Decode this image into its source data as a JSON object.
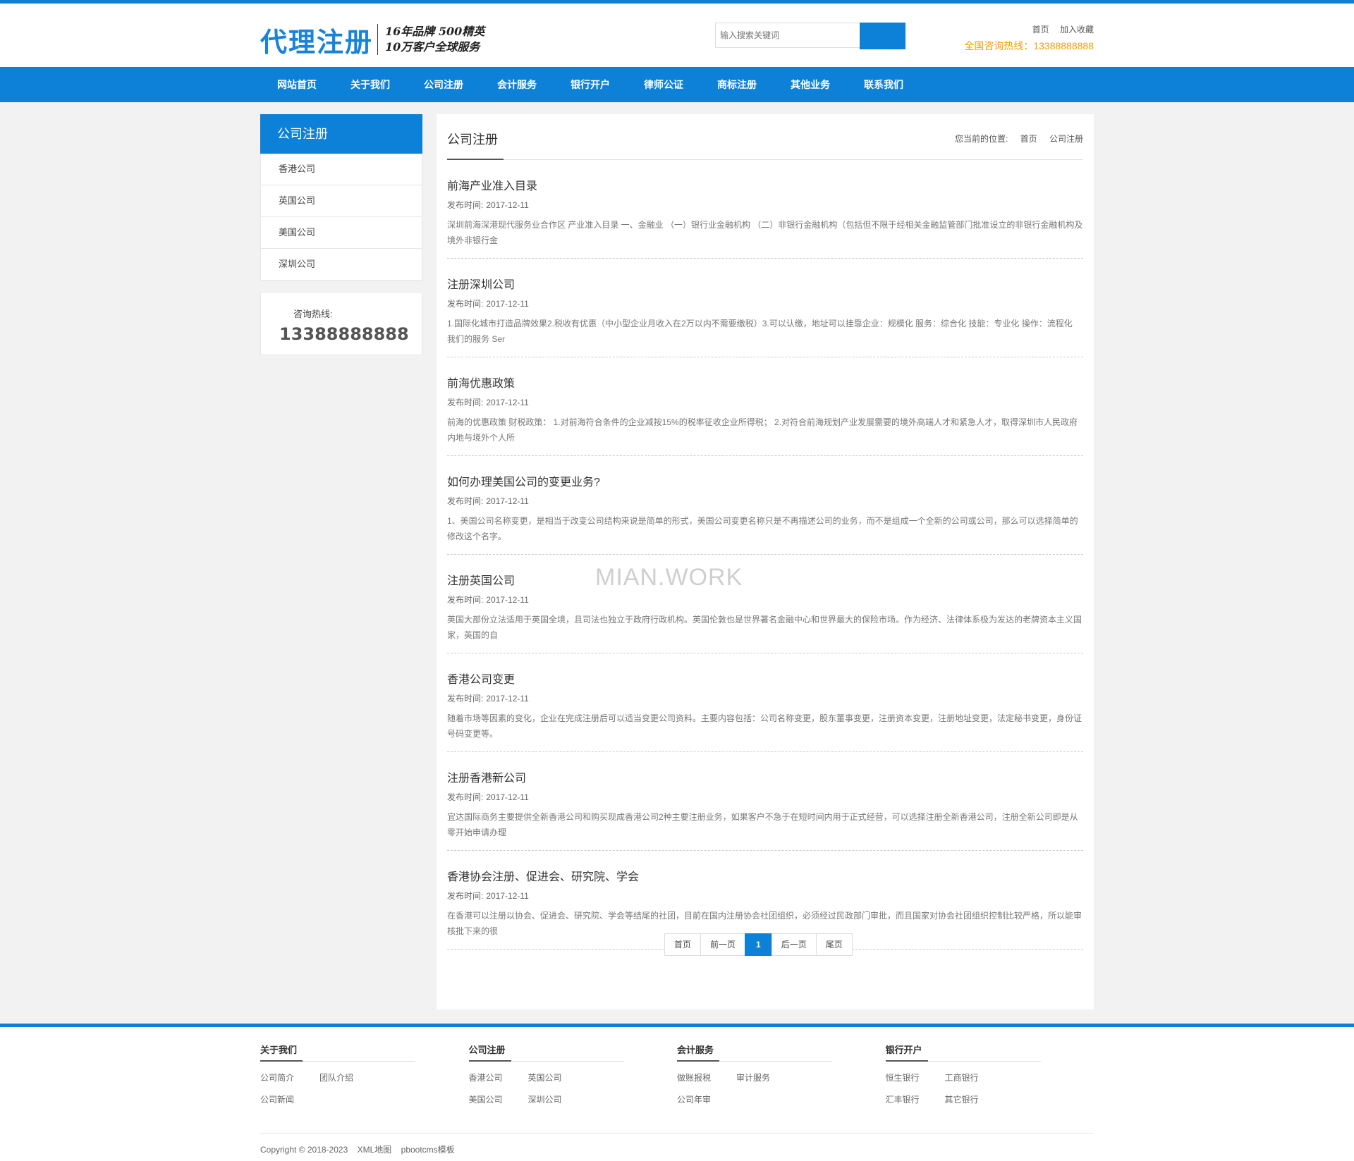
{
  "header": {
    "logo": "代理注册",
    "slogan_line1": "16年品牌 500精英",
    "slogan_line2": "10万客户全球服务",
    "search_placeholder": "输入搜索关键词",
    "links": [
      "首页",
      "加入收藏"
    ],
    "hotline": "全国咨询热线：13388888888"
  },
  "nav": [
    "网站首页",
    "关于我们",
    "公司注册",
    "会计服务",
    "银行开户",
    "律师公证",
    "商标注册",
    "其他业务",
    "联系我们"
  ],
  "sidebar": {
    "title": "公司注册",
    "items": [
      "香港公司",
      "英国公司",
      "美国公司",
      "深圳公司"
    ],
    "hotline_label": "咨询热线:",
    "hotline_number": "13388888888"
  },
  "main": {
    "title": "公司注册",
    "breadcrumb_label": "您当前的位置:",
    "breadcrumb": [
      "首页",
      "公司注册"
    ],
    "date_label": "发布时间:",
    "articles": [
      {
        "title": "前海产业准入目录",
        "date": "2017-12-11",
        "summary": "深圳前海深港现代服务业合作区 产业准入目录 一、金融业 （一）银行业金融机构 （二）非银行金融机构（包括但不限于经相关金融监管部门批准设立的非银行金融机构及境外非银行金"
      },
      {
        "title": "注册深圳公司",
        "date": "2017-12-11",
        "summary": "1.国际化城市打造品牌效果2.税收有优惠（中小型企业月收入在2万以内不需要缴税）3.可以认缴，地址可以挂靠企业：规模化 服务：综合化 技能：专业化 操作：流程化 我们的服务 Ser"
      },
      {
        "title": "前海优惠政策",
        "date": "2017-12-11",
        "summary": "前海的优惠政策 财税政策： 1.对前海符合条件的企业减按15%的税率征收企业所得税； 2.对符合前海规划产业发展需要的境外高端人才和紧急人才，取得深圳市人民政府内地与境外个人所"
      },
      {
        "title": "如何办理美国公司的变更业务?",
        "date": "2017-12-11",
        "summary": "1、美国公司名称变更，是相当于改变公司结构来说是简单的形式，美国公司变更名称只是不再描述公司的业务，而不是组成一个全新的公司或公司，那么可以选择简单的修改这个名字。"
      },
      {
        "title": "注册英国公司",
        "date": "2017-12-11",
        "summary": "英国大部份立法适用于英国全境，且司法也独立于政府行政机构。英国伦敦也是世界著名金融中心和世界最大的保险市场。作为经济、法律体系极为发达的老牌资本主义国家，英国的自"
      },
      {
        "title": "香港公司变更",
        "date": "2017-12-11",
        "summary": "随着市场等因素的变化，企业在完成注册后可以适当变更公司资料。主要内容包括：公司名称变更，股东董事变更，注册资本变更，注册地址变更，法定秘书变更，身份证号码变更等。"
      },
      {
        "title": "注册香港新公司",
        "date": "2017-12-11",
        "summary": "宜达国际商务主要提供全新香港公司和购买现成香港公司2种主要注册业务，如果客户不急于在短时间内用于正式经营，可以选择注册全新香港公司，注册全新公司即是从零开始申请办理"
      },
      {
        "title": "香港协会注册、促进会、研究院、学会",
        "date": "2017-12-11",
        "summary": "在香港可以注册以协会、促进会、研究院、学会等结尾的社团，目前在国内注册协会社团组织，必须经过民政部门审批，而且国家对协会社团组织控制比较严格，所以能审核批下来的很"
      }
    ],
    "watermark": "MIAN.WORK",
    "pager": [
      "首页",
      "前一页",
      "1",
      "后一页",
      "尾页"
    ]
  },
  "footer": {
    "columns": [
      {
        "title": "关于我们",
        "links": [
          "公司简介",
          "团队介绍",
          "公司新闻"
        ]
      },
      {
        "title": "公司注册",
        "links": [
          "香港公司",
          "英国公司",
          "美国公司",
          "深圳公司"
        ]
      },
      {
        "title": "会计服务",
        "links": [
          "做账报税",
          "审计服务",
          "公司年审"
        ]
      },
      {
        "title": "银行开户",
        "links": [
          "恒生银行",
          "工商银行",
          "汇丰银行",
          "其它银行"
        ]
      }
    ],
    "copyright": "Copyright © 2018-2023",
    "sitemap": "XML地图",
    "template": "pbootcms模板"
  },
  "colors": {
    "brand": "#0d80d8",
    "hotline": "#f0a000"
  }
}
